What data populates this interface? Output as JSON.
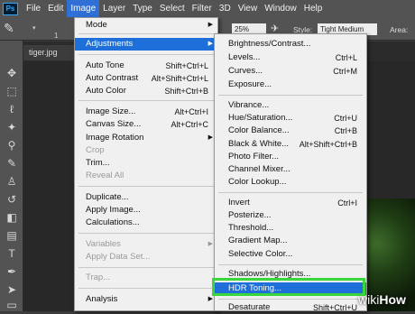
{
  "menubar": {
    "logo": "Ps",
    "items": [
      "File",
      "Edit",
      "Image",
      "Layer",
      "Type",
      "Select",
      "Filter",
      "3D",
      "View",
      "Window",
      "Help"
    ]
  },
  "options": {
    "brush_size": "1",
    "opacity_value": "25%",
    "style_label": "Style:",
    "style_value": "Tight Medium",
    "area_label": "Area:"
  },
  "document": {
    "tab_title": "tiger.jpg"
  },
  "image_menu": {
    "mode": "Mode",
    "adjustments": "Adjustments",
    "auto_tone": "Auto Tone",
    "auto_tone_sc": "Shift+Ctrl+L",
    "auto_contrast": "Auto Contrast",
    "auto_contrast_sc": "Alt+Shift+Ctrl+L",
    "auto_color": "Auto Color",
    "auto_color_sc": "Shift+Ctrl+B",
    "image_size": "Image Size...",
    "image_size_sc": "Alt+Ctrl+I",
    "canvas_size": "Canvas Size...",
    "canvas_size_sc": "Alt+Ctrl+C",
    "image_rotation": "Image Rotation",
    "crop": "Crop",
    "trim": "Trim...",
    "reveal_all": "Reveal All",
    "duplicate": "Duplicate...",
    "apply_image": "Apply Image...",
    "calculations": "Calculations...",
    "variables": "Variables",
    "apply_data_set": "Apply Data Set...",
    "trap": "Trap...",
    "analysis": "Analysis"
  },
  "adjustments_menu": {
    "brightness_contrast": "Brightness/Contrast...",
    "levels": "Levels...",
    "levels_sc": "Ctrl+L",
    "curves": "Curves...",
    "curves_sc": "Ctrl+M",
    "exposure": "Exposure...",
    "vibrance": "Vibrance...",
    "hue_saturation": "Hue/Saturation...",
    "hue_saturation_sc": "Ctrl+U",
    "color_balance": "Color Balance...",
    "color_balance_sc": "Ctrl+B",
    "black_white": "Black & White...",
    "black_white_sc": "Alt+Shift+Ctrl+B",
    "photo_filter": "Photo Filter...",
    "channel_mixer": "Channel Mixer...",
    "color_lookup": "Color Lookup...",
    "invert": "Invert",
    "invert_sc": "Ctrl+I",
    "posterize": "Posterize...",
    "threshold": "Threshold...",
    "gradient_map": "Gradient Map...",
    "selective_color": "Selective Color...",
    "shadows_highlights": "Shadows/Highlights...",
    "hdr_toning": "HDR Toning...",
    "desaturate": "Desaturate",
    "desaturate_sc": "Shift+Ctrl+U"
  },
  "watermark": {
    "part1": "wiki",
    "part2": "How"
  },
  "colors": {
    "highlight": "#1e6fd9",
    "outline": "#39d63c"
  },
  "icons": [
    "move-icon",
    "marquee-icon",
    "lasso-icon",
    "magic-wand-icon",
    "eyedropper-icon",
    "brush-icon",
    "stamp-icon",
    "history-brush-icon",
    "eraser-icon",
    "gradient-icon",
    "type-icon",
    "pen-icon",
    "path-select-icon",
    "rectangle-icon",
    "hand-icon"
  ]
}
